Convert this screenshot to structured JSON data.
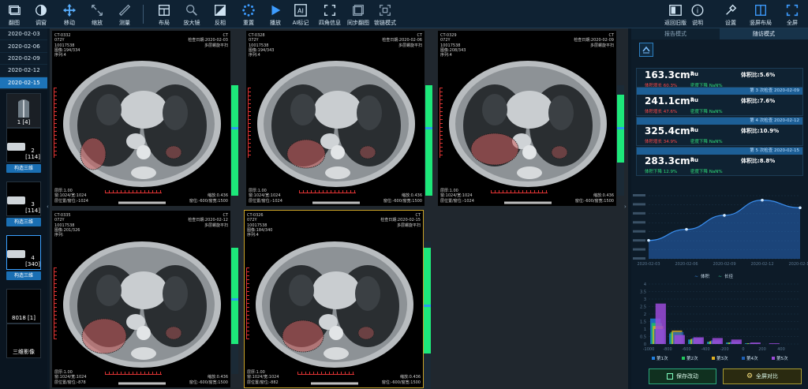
{
  "toolbar": {
    "items": [
      {
        "label": "翻图",
        "icon": "stack-icon"
      },
      {
        "label": "调窗",
        "icon": "contrast-icon"
      },
      {
        "label": "移动",
        "icon": "move-icon"
      },
      {
        "label": "缩放",
        "icon": "zoom-icon"
      },
      {
        "label": "测量",
        "icon": "ruler-icon"
      },
      {
        "label": "布局",
        "icon": "layout-icon"
      },
      {
        "label": "放大镜",
        "icon": "magnifier-icon"
      },
      {
        "label": "反相",
        "icon": "invert-icon"
      },
      {
        "label": "重置",
        "icon": "reset-icon"
      },
      {
        "label": "播放",
        "icon": "play-icon"
      },
      {
        "label": "AI标记",
        "icon": "ai-icon"
      },
      {
        "label": "四角信息",
        "icon": "corners-icon"
      },
      {
        "label": "同步翻图",
        "icon": "sync-icon"
      },
      {
        "label": "锁链模式",
        "icon": "link-icon"
      }
    ],
    "right_items": [
      {
        "label": "返回旧版",
        "icon": "back-icon"
      },
      {
        "label": "说明",
        "icon": "info-icon"
      },
      {
        "label": "设置",
        "icon": "settings-icon"
      },
      {
        "label": "竖屏布局",
        "icon": "portrait-icon"
      },
      {
        "label": "全屏",
        "icon": "fullscreen-icon"
      }
    ]
  },
  "dates": [
    "2020-02-03",
    "2020-02-06",
    "2020-02-09",
    "2020-02-12",
    "2020-02-15"
  ],
  "series": [
    {
      "caption": "1 [4]",
      "button": ""
    },
    {
      "caption": "2 [114]",
      "button": "构造三维"
    },
    {
      "caption": "3 [114]",
      "button": "构造三维"
    },
    {
      "caption": "4 [340]",
      "button": "构造三维"
    },
    {
      "caption": "8018 [1]",
      "button": ""
    },
    {
      "caption": "三维影像",
      "button": ""
    }
  ],
  "panels": [
    {
      "id": "CT-0332",
      "line1": "072Y",
      "line2": "10017538",
      "line3": "图像:194/334",
      "line4": "序列:4",
      "tr1": "CT",
      "tr2": "检查日期:2020-02-03",
      "tr3": "多层螺旋平扫",
      "bl1": "层厚:1.00",
      "bl2": "窗:1024/宽:1024",
      "bl3": "层位置/窗位:-1024",
      "br1": "缩放:0.436",
      "br2": "窗位:-600/窗宽:1500"
    },
    {
      "id": "CT-0328",
      "line1": "072Y",
      "line2": "10017538",
      "line3": "图像:194/343",
      "line4": "序列:4",
      "tr1": "CT",
      "tr2": "检查日期:2020-02-06",
      "tr3": "多层螺旋平扫",
      "bl1": "层厚:1.00",
      "bl2": "窗:1024/宽:1024",
      "bl3": "层位置/窗位:-1024",
      "br1": "缩放:0.436",
      "br2": "窗位:-600/窗宽:1500"
    },
    {
      "id": "CT-0329",
      "line1": "072Y",
      "line2": "10017538",
      "line3": "图像:208/343",
      "line4": "序列:4",
      "tr1": "CT",
      "tr2": "检查日期:2020-02-09",
      "tr3": "多层螺旋平扫",
      "bl1": "层厚:1.00",
      "bl2": "窗:1024/宽:1024",
      "bl3": "层位置/窗位:-1024",
      "br1": "缩放:0.436",
      "br2": "窗位:-600/窗宽:1500"
    },
    {
      "id": "CT-0335",
      "line1": "072Y",
      "line2": "10017538",
      "line3": "图像:201/326",
      "line4": "序列:",
      "tr1": "CT",
      "tr2": "检查日期:2020-02-12",
      "tr3": "多层螺旋平扫",
      "bl1": "层厚:1.00",
      "bl2": "窗:1024/宽:1024",
      "bl3": "层位置/窗位:-878",
      "br1": "缩放:0.436",
      "br2": "窗位:-600/窗宽:1500"
    },
    {
      "id": "CT-0326",
      "line1": "072Y",
      "line2": "10017538",
      "line3": "图像:184/340",
      "line4": "序列:4",
      "tr1": "CT",
      "tr2": "检查日期:2020-02-15",
      "tr3": "多层螺旋平扫",
      "bl1": "层厚:1.00",
      "bl2": "窗:1024/宽:1024",
      "bl3": "层位置/窗位:-882",
      "br1": "缩放:0.436",
      "br2": "窗位:-600/窗宽:1500"
    }
  ],
  "right_panel": {
    "tabs": [
      "报告模式",
      "随访模式"
    ],
    "active_tab": 1,
    "cards": [
      {
        "head": "",
        "volume": "163.3cm³",
        "hu": "hu",
        "ratio": "体积比:5.6%",
        "change": "体积增长 60.3%",
        "density": "密度下降 NaN%",
        "change_color": "#ff4a4a"
      },
      {
        "head": "第 3 次检查  2020-02-09",
        "volume": "241.1cm³",
        "hu": "hu",
        "ratio": "体积比:7.6%",
        "change": "体积增长 47.6%",
        "density": "密度下降 NaN%",
        "change_color": "#ff4a4a"
      },
      {
        "head": "第 4 次检查  2020-02-12",
        "volume": "325.4cm³",
        "hu": "hu",
        "ratio": "体积比:10.9%",
        "change": "体积增长 34.9%",
        "density": "密度下降 NaN%",
        "change_color": "#ff4a4a"
      },
      {
        "head": "第 5 次检查  2020-02-15",
        "volume": "283.3cm³",
        "hu": "hu",
        "ratio": "体积比:8.8%",
        "change": "体积下降 12.9%",
        "density": "密度下降 NaN%",
        "change_color": "#2fe07a"
      }
    ],
    "buttons": {
      "save": "保存改动",
      "compare": "全屏对比"
    }
  },
  "chart_data": [
    {
      "type": "line",
      "x": [
        "2020-02-03",
        "2020-02-06",
        "2020-02-09",
        "2020-02-12",
        "2020-02-15"
      ],
      "series": [
        {
          "name": "体积",
          "values": [
            102,
            163.3,
            241.1,
            325.4,
            283.3
          ],
          "color": "#3a8ff0"
        },
        {
          "name": "长径",
          "values": [],
          "color": "#2fd29a"
        }
      ],
      "ylim": [
        0,
        350
      ]
    },
    {
      "type": "bar",
      "categories": [
        "-1000",
        "-800",
        "-600",
        "-400",
        "-200",
        "0",
        "200",
        "400"
      ],
      "series": [
        {
          "name": "第1次",
          "values": [
            0.17,
            0.07,
            0.03,
            0.015,
            0.01,
            0.005,
            0,
            0
          ],
          "color": "#1f7fe0"
        },
        {
          "name": "第2次",
          "values": [
            0.14,
            0.08,
            0.03,
            0.015,
            0.01,
            0.005,
            0,
            0
          ],
          "color": "#20c55b"
        },
        {
          "name": "第3次",
          "values": [
            0.12,
            0.09,
            0.035,
            0.02,
            0.01,
            0.005,
            0,
            0
          ],
          "color": "#e0b020"
        },
        {
          "name": "第4次",
          "values": [
            0.1,
            0.08,
            0.04,
            0.025,
            0.015,
            0.005,
            0,
            0
          ],
          "color": "#1d5fb5"
        },
        {
          "name": "第5次",
          "values": [
            0.27,
            0.06,
            0.045,
            0.04,
            0.03,
            0.01,
            0.005,
            0
          ],
          "color": "#9b4ad8"
        }
      ],
      "y_ticks": [
        "0",
        "0.5",
        "1",
        "1.5",
        "2",
        "2.5",
        "3",
        "3.5",
        "4"
      ],
      "ylim": [
        0,
        0.4
      ]
    }
  ]
}
